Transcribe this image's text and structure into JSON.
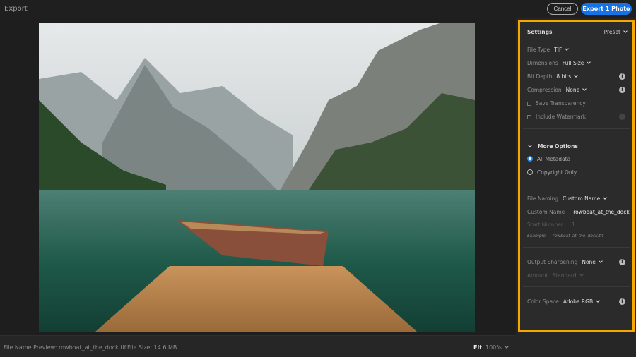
{
  "header": {
    "title": "Export",
    "cancel_label": "Cancel",
    "export_label": "Export 1 Photo"
  },
  "footer": {
    "file_name_preview": "File Name Preview: rowboat_at_the_dock.tif",
    "file_size": "File Size: 14.6 MB",
    "fit_label": "Fit",
    "zoom": "100%"
  },
  "settings": {
    "title": "Settings",
    "preset_label": "Preset",
    "file_type": {
      "label": "File Type",
      "value": "TIF"
    },
    "dimensions": {
      "label": "Dimensions",
      "value": "Full Size"
    },
    "bit_depth": {
      "label": "Bit Depth",
      "value": "8 bits"
    },
    "compression": {
      "label": "Compression",
      "value": "None"
    },
    "save_transparency": {
      "label": "Save Transparency",
      "checked": false
    },
    "include_watermark": {
      "label": "Include Watermark",
      "checked": false
    },
    "more_options": {
      "label": "More Options",
      "options": [
        "All Metadata",
        "Copyright Only"
      ],
      "selected": "All Metadata"
    },
    "file_naming": {
      "label": "File Naming",
      "value": "Custom Name"
    },
    "custom_name": {
      "label": "Custom Name",
      "value": "rowboat_at_the_dock"
    },
    "start_number": {
      "label": "Start Number",
      "value": "1"
    },
    "example": {
      "label": "Example",
      "value": "rowboat_at_the_dock.tif"
    },
    "output_sharpening": {
      "label": "Output Sharpening",
      "value": "None"
    },
    "amount": {
      "label": "Amount",
      "value": "Standard"
    },
    "color_space": {
      "label": "Color Space",
      "value": "Adobe RGB"
    },
    "info_glyph": "i"
  },
  "colors": {
    "accent": "#1473e6",
    "highlight": "#f6a800"
  }
}
